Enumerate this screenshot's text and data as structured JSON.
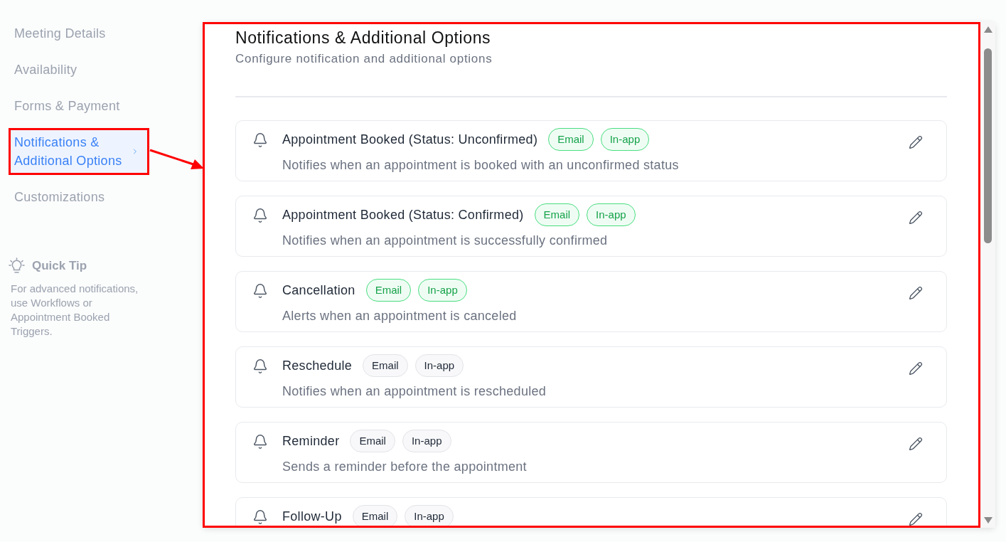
{
  "sidebar": {
    "items": [
      {
        "label": "Meeting Details",
        "selected": false,
        "highlighted": false
      },
      {
        "label": "Availability",
        "selected": false,
        "highlighted": false
      },
      {
        "label": "Forms & Payment",
        "selected": false,
        "highlighted": false
      },
      {
        "label": "Notifications & Additional Options",
        "selected": true,
        "highlighted": true
      },
      {
        "label": "Customizations",
        "selected": false,
        "highlighted": false
      }
    ],
    "quick_tip": {
      "title": "Quick Tip",
      "text": "For advanced notifications, use Workflows or Appointment Booked Triggers."
    }
  },
  "annotation": {
    "arrow": true
  },
  "panel": {
    "highlighted": true,
    "title": "Notifications & Additional Options",
    "subtitle": "Configure notification and additional options",
    "notifications": [
      {
        "title": "Appointment Booked (Status: Unconfirmed)",
        "description": "Notifies when an appointment is booked with an unconfirmed status",
        "channels": [
          {
            "label": "Email",
            "on": true
          },
          {
            "label": "In-app",
            "on": true
          }
        ]
      },
      {
        "title": "Appointment Booked (Status: Confirmed)",
        "description": "Notifies when an appointment is successfully confirmed",
        "channels": [
          {
            "label": "Email",
            "on": true
          },
          {
            "label": "In-app",
            "on": true
          }
        ]
      },
      {
        "title": "Cancellation",
        "description": "Alerts when an appointment is canceled",
        "channels": [
          {
            "label": "Email",
            "on": true
          },
          {
            "label": "In-app",
            "on": true
          }
        ]
      },
      {
        "title": "Reschedule",
        "description": "Notifies when an appointment is rescheduled",
        "channels": [
          {
            "label": "Email",
            "on": false
          },
          {
            "label": "In-app",
            "on": false
          }
        ]
      },
      {
        "title": "Reminder",
        "description": "Sends a reminder before the appointment",
        "channels": [
          {
            "label": "Email",
            "on": false
          },
          {
            "label": "In-app",
            "on": false
          }
        ]
      },
      {
        "title": "Follow-Up",
        "channels": [
          {
            "label": "Email",
            "on": false
          },
          {
            "label": "In-app",
            "on": false
          }
        ]
      }
    ]
  }
}
